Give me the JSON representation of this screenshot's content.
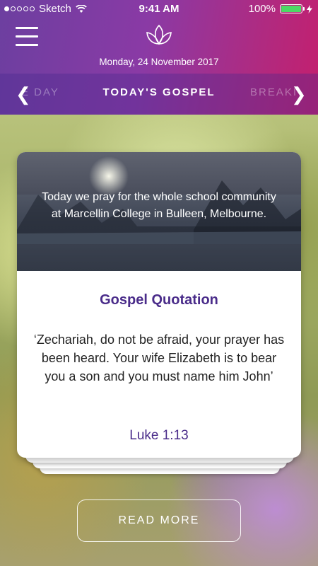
{
  "status_bar": {
    "carrier": "Sketch",
    "time": "9:41 AM",
    "battery": "100%"
  },
  "header": {
    "date": "Monday, 24 November 2017",
    "tabs": {
      "left": "E DAY",
      "active": "TODAY'S GOSPEL",
      "right": "BREAKI"
    },
    "left_arrow": "❮",
    "right_arrow": "❯"
  },
  "card": {
    "message": "Today we pray for the whole school community at Marcellin College in Bulleen, Melbourne.",
    "title": "Gospel Quotation",
    "quote": "‘Zechariah, do not be afraid, your prayer has been heard. Your wife Elizabeth is to bear you a son and you must name him John’",
    "reference": "Luke 1:13"
  },
  "read_more_label": "READ MORE",
  "colors": {
    "header_start": "#6c3fa0",
    "header_end": "#c41f6e",
    "accent": "#4a2c8a",
    "battery_fill": "#4cd964"
  },
  "icons": [
    "signal-dots-icon",
    "wifi-icon",
    "battery-icon",
    "charging-icon",
    "menu-icon",
    "lotus-logo-icon",
    "chevron-left-icon",
    "chevron-right-icon"
  ]
}
